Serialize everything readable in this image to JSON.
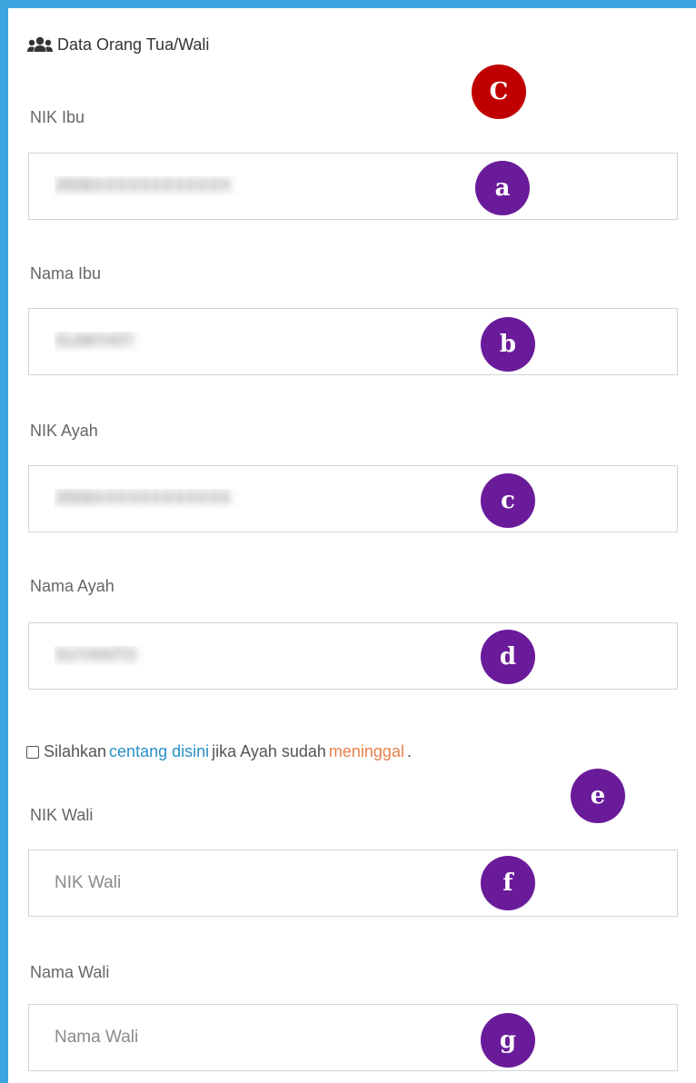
{
  "section": {
    "title": "Data Orang Tua/Wali",
    "icon": "users-icon"
  },
  "badges": {
    "main": {
      "label": "C",
      "color": "#c00000"
    },
    "a": {
      "label": "a",
      "color": "#6a1b9a"
    },
    "b": {
      "label": "b",
      "color": "#6a1b9a"
    },
    "c": {
      "label": "c",
      "color": "#6a1b9a"
    },
    "d": {
      "label": "d",
      "color": "#6a1b9a"
    },
    "e": {
      "label": "e",
      "color": "#6a1b9a"
    },
    "f": {
      "label": "f",
      "color": "#6a1b9a"
    },
    "g": {
      "label": "g",
      "color": "#6a1b9a"
    }
  },
  "fields": {
    "nik_ibu": {
      "label": "NIK Ibu",
      "value": "3506XXXXXXXXXXXX"
    },
    "nama_ibu": {
      "label": "Nama Ibu",
      "value": "SUMIYATI"
    },
    "nik_ayah": {
      "label": "NIK Ayah",
      "value": "3506XXXXXXXXXXXX"
    },
    "nama_ayah": {
      "label": "Nama Ayah",
      "value": "SUYANTO"
    },
    "nik_wali": {
      "label": "NIK Wali",
      "placeholder": "NIK Wali"
    },
    "nama_wali": {
      "label": "Nama Wali",
      "placeholder": "Nama Wali"
    }
  },
  "deceased_check": {
    "checked": false,
    "prefix": "Silahkan",
    "link": "centang disini",
    "middle": "jika Ayah sudah",
    "highlight": "meninggal",
    "suffix": "."
  },
  "colors": {
    "frame_border": "#3aa6dd",
    "link": "#2b8fc6",
    "highlight": "#e8814c"
  }
}
